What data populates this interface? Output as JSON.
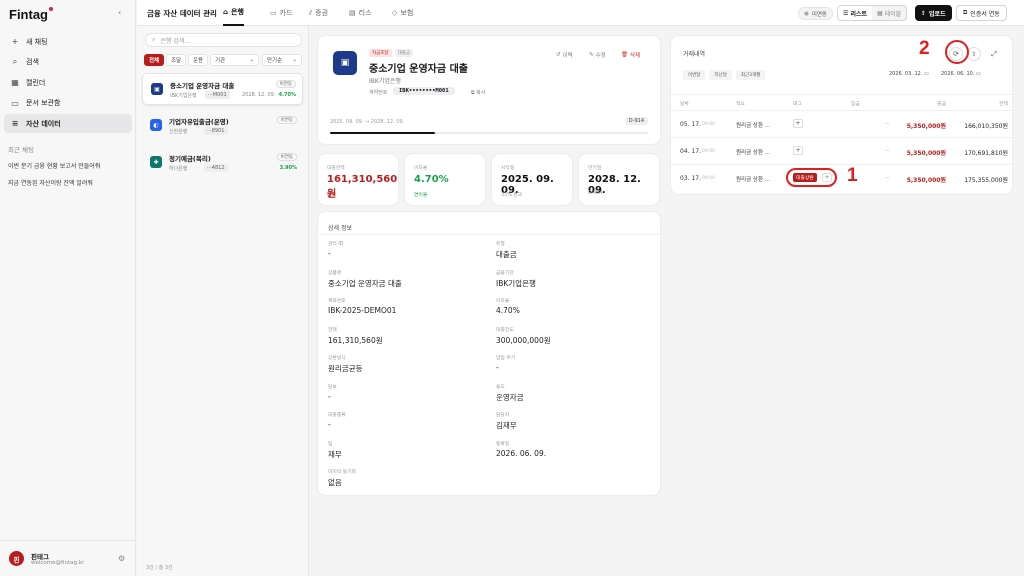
{
  "sidebar": {
    "logo": "Fintag",
    "nav": [
      {
        "label": "새 채팅",
        "icon": "plus-icon"
      },
      {
        "label": "검색",
        "icon": "search-icon"
      },
      {
        "label": "캘린더",
        "icon": "calendar-icon"
      },
      {
        "label": "문서 보관함",
        "icon": "folder-icon"
      },
      {
        "label": "자산 데이터",
        "icon": "database-icon",
        "active": true
      }
    ],
    "recent_title": "최근 채팅",
    "recent": [
      "이번 분기 금융 현황 보고서 만들어줘",
      "지금 연동된 자산이랑 잔액 알려줘"
    ],
    "profile": {
      "avatar": "핀",
      "name": "핀태그",
      "email": "welcome@fintag.kr"
    }
  },
  "topbar": {
    "title": "금융 자산 데이터 관리",
    "tabs": [
      {
        "label": "은행",
        "icon": "bank-icon",
        "active": true
      },
      {
        "label": "카드",
        "icon": "card-icon"
      },
      {
        "label": "증권",
        "icon": "chart-icon"
      },
      {
        "label": "리스",
        "icon": "lease-icon"
      },
      {
        "label": "보험",
        "icon": "shield-icon"
      }
    ],
    "status": "미연동",
    "view_list": "리스트",
    "view_table": "테이블",
    "upload": "업로드",
    "cert": "인증서 연동"
  },
  "list": {
    "search_placeholder": "은행 검색...",
    "filters": [
      "전체",
      "조달",
      "운용",
      "기관",
      "만기순"
    ],
    "accounts": [
      {
        "name": "중소기업 운영자금 대출",
        "bank": "IBK기업은행",
        "number": "···M001",
        "badge": "비연동",
        "date": "2028. 12. 09.",
        "rate": "4.70%",
        "color": "#1e3a8a",
        "initial": "▣"
      },
      {
        "name": "기업자유입출금(운영)",
        "bank": "신한은행",
        "number": "···8901",
        "badge": "비연동",
        "date": "",
        "rate": "",
        "color": "#2563eb",
        "initial": "◐"
      },
      {
        "name": "정기예금(복리)",
        "bank": "하나은행",
        "number": "···4812",
        "badge": "비연동",
        "date": "",
        "rate": "3.90%",
        "color": "#0f766e",
        "initial": "✚"
      }
    ],
    "footnote": "3건 / 총 3건"
  },
  "detail": {
    "tags": [
      "자금조달",
      "대출금"
    ],
    "title": "중소기업 운영자금 대출",
    "bank": "IBK기업은행",
    "acct_label": "계약번호",
    "acct_number": "IBK••••••••M001",
    "copy": "복사",
    "actions": [
      "이력",
      "수정",
      "삭제"
    ],
    "period": "2025. 09. 09. → 2028. 12. 09.",
    "dday": "D-914",
    "progress": 0.33,
    "stats": [
      {
        "label": "대출잔액",
        "value": "161,310,560원",
        "sub": "잔액",
        "color": "#b91c1c"
      },
      {
        "label": "이자율",
        "value": "4.70%",
        "sub": "연이율",
        "color": "#16a34a"
      },
      {
        "label": "시작일",
        "value": "2025. 09. 09.",
        "sub": "33% 경과",
        "color": "#111111"
      },
      {
        "label": "만기일",
        "value": "2028. 12. 09.",
        "sub": "D-914",
        "color": "#111111"
      }
    ],
    "info_title": "상세 정보",
    "fields": [
      {
        "label": "관리 ID",
        "value": "-"
      },
      {
        "label": "유형",
        "value": "대출금"
      },
      {
        "label": "상품명",
        "value": "중소기업 운영자금 대출"
      },
      {
        "label": "금융기관",
        "value": "IBK기업은행"
      },
      {
        "label": "계좌번호",
        "value": "IBK-2025-DEMO01"
      },
      {
        "label": "이자율",
        "value": "4.70%"
      },
      {
        "label": "잔액",
        "value": "161,310,560원"
      },
      {
        "label": "대출한도",
        "value": "300,000,000원"
      },
      {
        "label": "상환방식",
        "value": "원리금균등"
      },
      {
        "label": "납입 주기",
        "value": "-"
      },
      {
        "label": "담보",
        "value": "-"
      },
      {
        "label": "용도",
        "value": "운영자금"
      },
      {
        "label": "대출종류",
        "value": "-"
      },
      {
        "label": "담당자",
        "value": "김재무"
      },
      {
        "label": "팀",
        "value": "재무"
      },
      {
        "label": "등록일",
        "value": "2026. 06. 09."
      },
      {
        "label": "마지막 동기화",
        "value": "없음"
      }
    ]
  },
  "tx": {
    "title": "거래내역",
    "ranges": [
      "이번달",
      "지난달",
      "최근3개월"
    ],
    "date_from": "2026. 03. 12.",
    "date_to": "2026. 06. 10.",
    "headers": [
      "날짜",
      "적요",
      "태그",
      "입금",
      "출금",
      "잔액"
    ],
    "rows": [
      {
        "date": "05. 17.",
        "time": "09:00",
        "memo": "원리금 상환 ...",
        "tag": "",
        "in": "—",
        "out": "5,350,000원",
        "bal": "166,010,350원"
      },
      {
        "date": "04. 17.",
        "time": "09:00",
        "memo": "원리금 상환 ...",
        "tag": "",
        "in": "—",
        "out": "5,350,000원",
        "bal": "170,691,810원"
      },
      {
        "date": "03. 17.",
        "time": "09:00",
        "memo": "원리금 상환 ...",
        "tag": "대출상환",
        "in": "—",
        "out": "5,350,000원",
        "bal": "175,355,000원"
      }
    ],
    "annot1": "1",
    "annot2": "2"
  }
}
